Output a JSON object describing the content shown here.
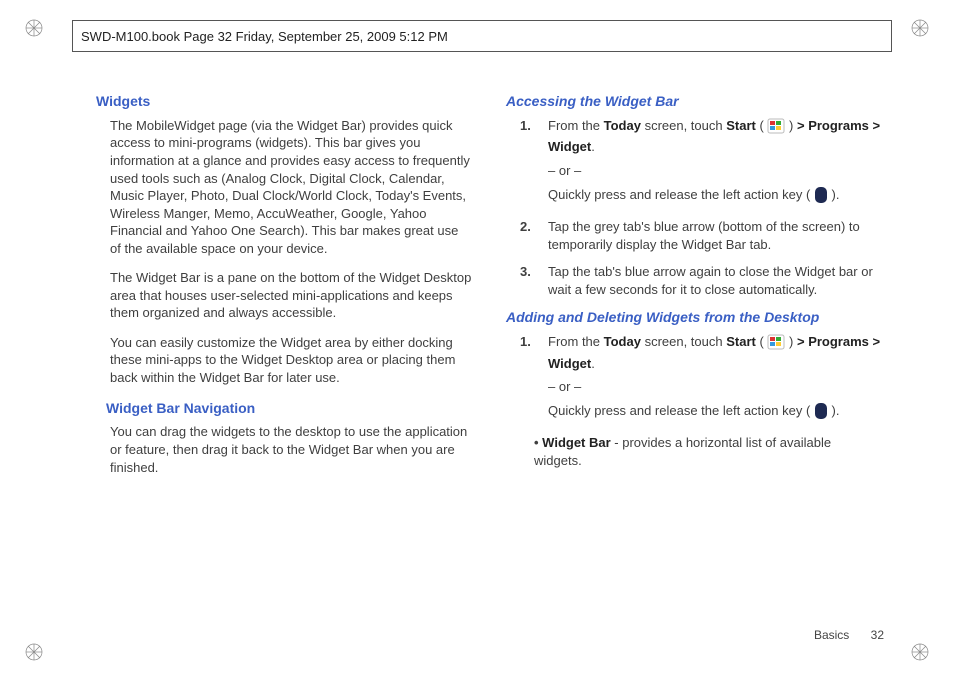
{
  "header": "SWD-M100.book  Page 32  Friday, September 25, 2009  5:12 PM",
  "left": {
    "h1": "Widgets",
    "p1": "The MobileWidget page (via the Widget Bar) provides quick access to mini-programs (widgets). This bar gives you information at a glance and provides easy access to frequently used tools such as (Analog Clock, Digital Clock, Calendar, Music Player, Photo, Dual Clock/World Clock, Today's Events, Wireless Manger, Memo, AccuWeather, Google, Yahoo Financial and Yahoo One Search). This bar makes great use of the available space on your device.",
    "p2": "The Widget Bar is a pane on the bottom of the Widget Desktop area that houses user-selected mini-applications and keeps them organized and always accessible.",
    "p3": "You can easily customize the Widget area by either docking these mini-apps to the Widget Desktop area or placing them back within the Widget Bar for later use.",
    "h2": "Widget Bar Navigation",
    "p4": "You can drag the widgets to the desktop to use the application or feature, then drag it back to the Widget Bar when you are finished."
  },
  "right": {
    "h1": "Accessing the Widget Bar",
    "steps1": {
      "s1a": "From the ",
      "s1b": "Today",
      "s1c": " screen, touch ",
      "s1d": "Start",
      "s1e": " ( ",
      "s1f": " ) ",
      "s1g": "> Programs > Widget",
      "s1h": ".",
      "s1or": "– or –",
      "s1i": "Quickly press and release the left action key ( ",
      "s1j": " ).",
      "s2": "Tap the grey tab's blue arrow (bottom of the screen) to temporarily display the Widget Bar tab.",
      "s3": "Tap the tab's blue arrow again to close the Widget bar or wait a few seconds for it to close automatically."
    },
    "h2": "Adding and Deleting Widgets from the Desktop",
    "steps2": {
      "s1a": "From the ",
      "s1b": "Today",
      "s1c": " screen, touch ",
      "s1d": "Start",
      "s1e": " ( ",
      "s1f": " ) ",
      "s1g": "> Programs > Widget",
      "s1h": ".",
      "s1or": "– or –",
      "s1i": "Quickly press and release the left action key ( ",
      "s1j": " )."
    },
    "bullet_b": "Widget Bar",
    "bullet_t": " - provides a horizontal list of available widgets."
  },
  "footer": {
    "section": "Basics",
    "page": "32"
  }
}
